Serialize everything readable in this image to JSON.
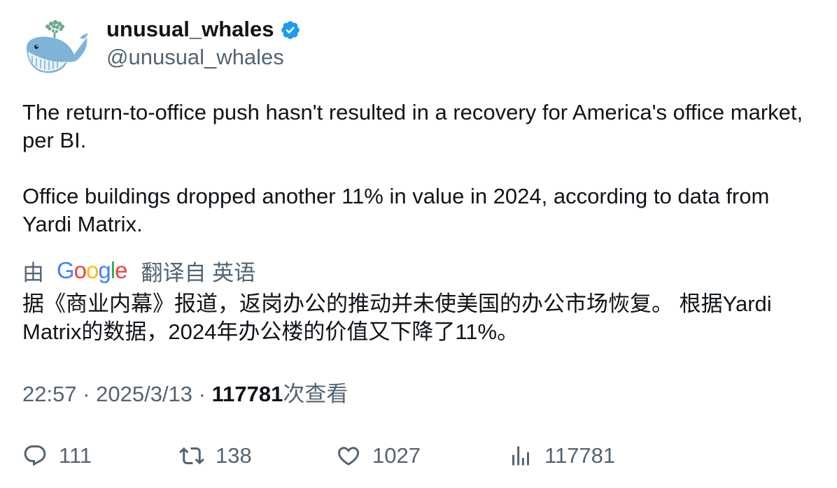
{
  "user": {
    "display_name": "unusual_whales",
    "handle": "@unusual_whales",
    "verified": true,
    "verified_color": "#1d9bf0"
  },
  "tweet": {
    "paragraphs": [
      "The return-to-office push hasn't resulted in a recovery for America's office market, per BI.",
      "Office buildings dropped another 11% in value in 2024, according to data from Yardi Matrix."
    ]
  },
  "translation": {
    "by_label": "由",
    "provider": "Google",
    "translated_from_label": "翻译自 英语",
    "text": "据《商业内幕》报道，返岗办公的推动并未使美国的办公市场恢复。 根据Yardi Matrix的数据，2024年办公楼的价值又下降了11%。"
  },
  "meta": {
    "time": "22:57",
    "separator": " · ",
    "date": "2025/3/13",
    "views_count": "117781",
    "views_label": "次查看"
  },
  "actions": {
    "replies": "111",
    "retweets": "138",
    "likes": "1027",
    "views": "117781"
  },
  "colors": {
    "text_primary": "#0f1419",
    "text_secondary": "#536471",
    "accent": "#1d9bf0"
  }
}
